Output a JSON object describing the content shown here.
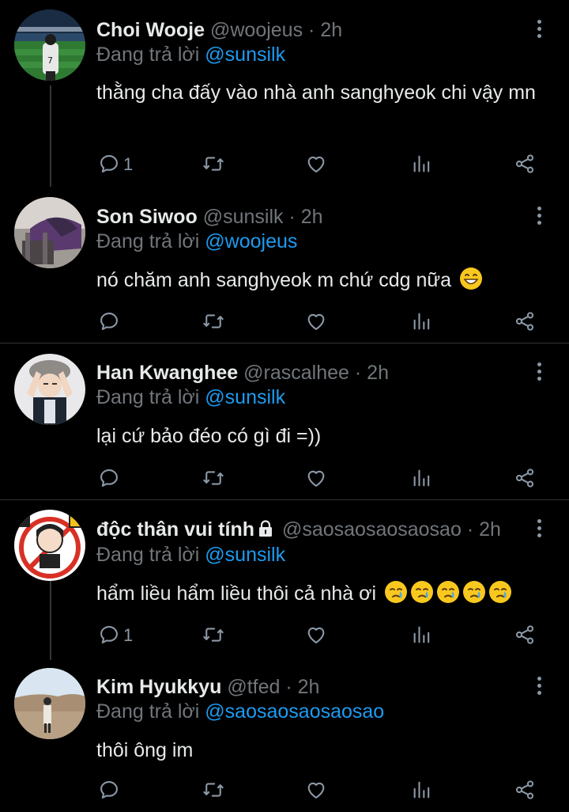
{
  "colors": {
    "background": "#000000",
    "text": "#e7e9ea",
    "muted": "#71767b",
    "accent": "#1d9bf0",
    "separator": "#2f3336",
    "icon": "#8b98a5"
  },
  "labels": {
    "replying_to": "Đang trả lời"
  },
  "tweets": [
    {
      "name": "Choi Wooje",
      "handle": "@woojeus",
      "time": "· 2h",
      "replying_to": "@sunsilk",
      "text": "thằng cha đấy vào nhà anh sanghyeok chi vậy mn",
      "reply_count": "1",
      "icons": [
        "reply-icon",
        "retweet-icon",
        "like-icon",
        "views-icon",
        "share-icon"
      ]
    },
    {
      "name": "Son Siwoo",
      "handle": "@sunsilk",
      "time": "· 2h",
      "replying_to": "@woojeus",
      "text": "nó chăm anh sanghyeok m chứ cdg nữa",
      "emoji": "grinning-face-emoji",
      "reply_count": ""
    },
    {
      "name": "Han Kwanghee",
      "handle": "@rascalhee",
      "time": "· 2h",
      "replying_to": "@sunsilk",
      "text": "lại cứ bảo đéo có gì đi =))",
      "reply_count": ""
    },
    {
      "name": "độc thân vui tính",
      "protected_icon": "lock-icon",
      "handle": "@saosaosaosaosao",
      "time": "· 2h",
      "replying_to": "@sunsilk",
      "text": "hẩm liều hẩm liều thôi cả nhà ơi",
      "emoji": "crying-face-emoji x5",
      "reply_count": "1"
    },
    {
      "name": "Kim Hyukkyu",
      "handle": "@tfed",
      "time": "· 2h",
      "replying_to": "@saosaosaosaosao",
      "text": "thôi ông im",
      "reply_count": ""
    }
  ]
}
